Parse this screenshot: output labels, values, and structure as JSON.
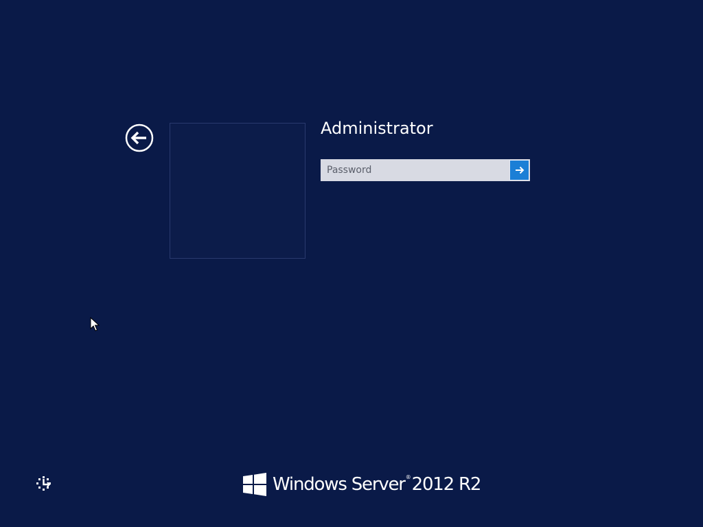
{
  "login": {
    "username": "Administrator",
    "password_placeholder": "Password",
    "password_value": ""
  },
  "icons": {
    "back": "back-arrow-icon",
    "submit": "arrow-right-icon",
    "ease_of_access": "ease-of-access-icon",
    "logo": "windows-logo-icon"
  },
  "branding": {
    "product_name": "Windows Server",
    "trademark": "®",
    "version": "2012 R2"
  },
  "colors": {
    "background": "#0a1a48",
    "accent": "#1b7fd6",
    "input_background": "#d8dae3"
  }
}
